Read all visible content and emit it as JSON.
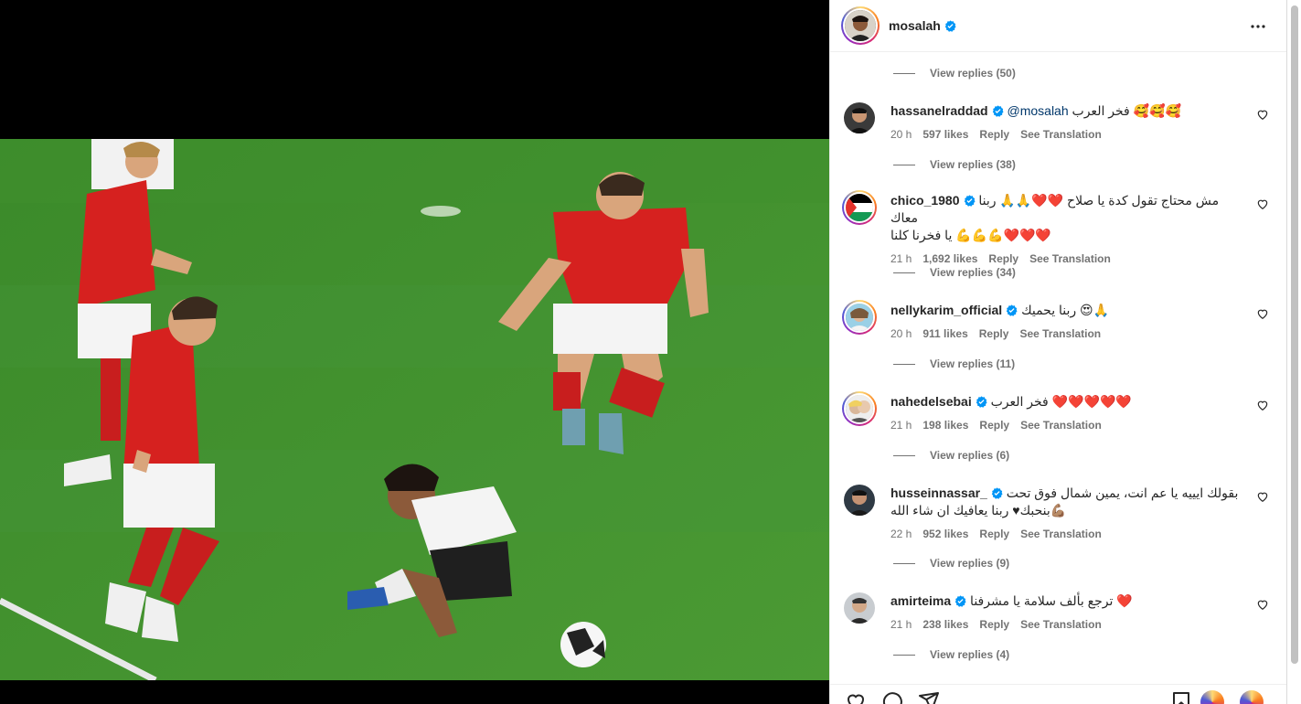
{
  "post": {
    "author": "mosalah",
    "author_verified": true
  },
  "comments": [
    {
      "replies_above": "View replies (50)",
      "username": "hassanelraddad",
      "mention": "@mosalah",
      "text": "فخر العرب 🥰🥰🥰",
      "time": "20 h",
      "likes": "597 likes",
      "reply": "Reply",
      "translate": "See Translation",
      "replies": "View replies (38)"
    },
    {
      "username": "chico_1980",
      "text": "مش محتاج تقول كدة يا صلاح ❤️❤️🙏🙏 ربنا معاك",
      "text2": "يا فخرنا كلنا 💪💪💪❤️❤️❤️",
      "time": "21 h",
      "likes": "1,692 likes",
      "reply": "Reply",
      "translate": "See Translation",
      "replies": "View replies (34)"
    },
    {
      "username": "nellykarim_official",
      "text": "ربنا يحميك 😍🙏",
      "time": "20 h",
      "likes": "911 likes",
      "reply": "Reply",
      "translate": "See Translation",
      "replies": "View replies (11)"
    },
    {
      "username": "nahedelsebai",
      "text": "فخر العرب ❤️❤️❤️❤️❤️",
      "time": "21 h",
      "likes": "198 likes",
      "reply": "Reply",
      "translate": "See Translation",
      "replies": "View replies (6)"
    },
    {
      "username": "husseinnassar_",
      "text": "بقولك ايييه يا عم انت، يمين شمال فوق تحت",
      "text2": "بنحبك♥ ربنا يعافيك ان شاء الله💪🏽",
      "time": "22 h",
      "likes": "952 likes",
      "reply": "Reply",
      "translate": "See Translation",
      "replies": "View replies (9)"
    },
    {
      "username": "amirteima",
      "text": "ترجع بألف سلامة يا مشرفنا ❤️",
      "time": "21 h",
      "likes": "238 likes",
      "reply": "Reply",
      "translate": "See Translation",
      "replies": "View replies (4)"
    }
  ],
  "icons": {
    "more": "more-options-icon",
    "verified": "verified-badge-icon",
    "heart": "heart-icon",
    "comment": "comment-icon",
    "share": "share-icon",
    "save": "bookmark-icon"
  },
  "colors": {
    "verified": "#0095f6",
    "link": "#00376b",
    "secondary": "#737373"
  }
}
